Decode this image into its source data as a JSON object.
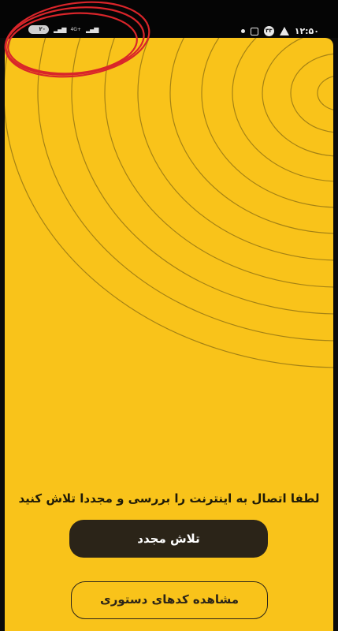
{
  "status_bar": {
    "battery_level": "۲۰",
    "network_label": "4G+",
    "notification_badge": "۳۳",
    "time": "۱۲:۵۰"
  },
  "main": {
    "message": "لطفا اتصال به اینترنت را بررسی و مجددا تلاش کنید",
    "retry_button_label": "تلاش مجدد",
    "view_commands_button_label": "مشاهده کدهای دستوری"
  },
  "colors": {
    "background": "#f9c31a",
    "button_dark": "#2b2418",
    "annotation_red": "#d9252a"
  }
}
